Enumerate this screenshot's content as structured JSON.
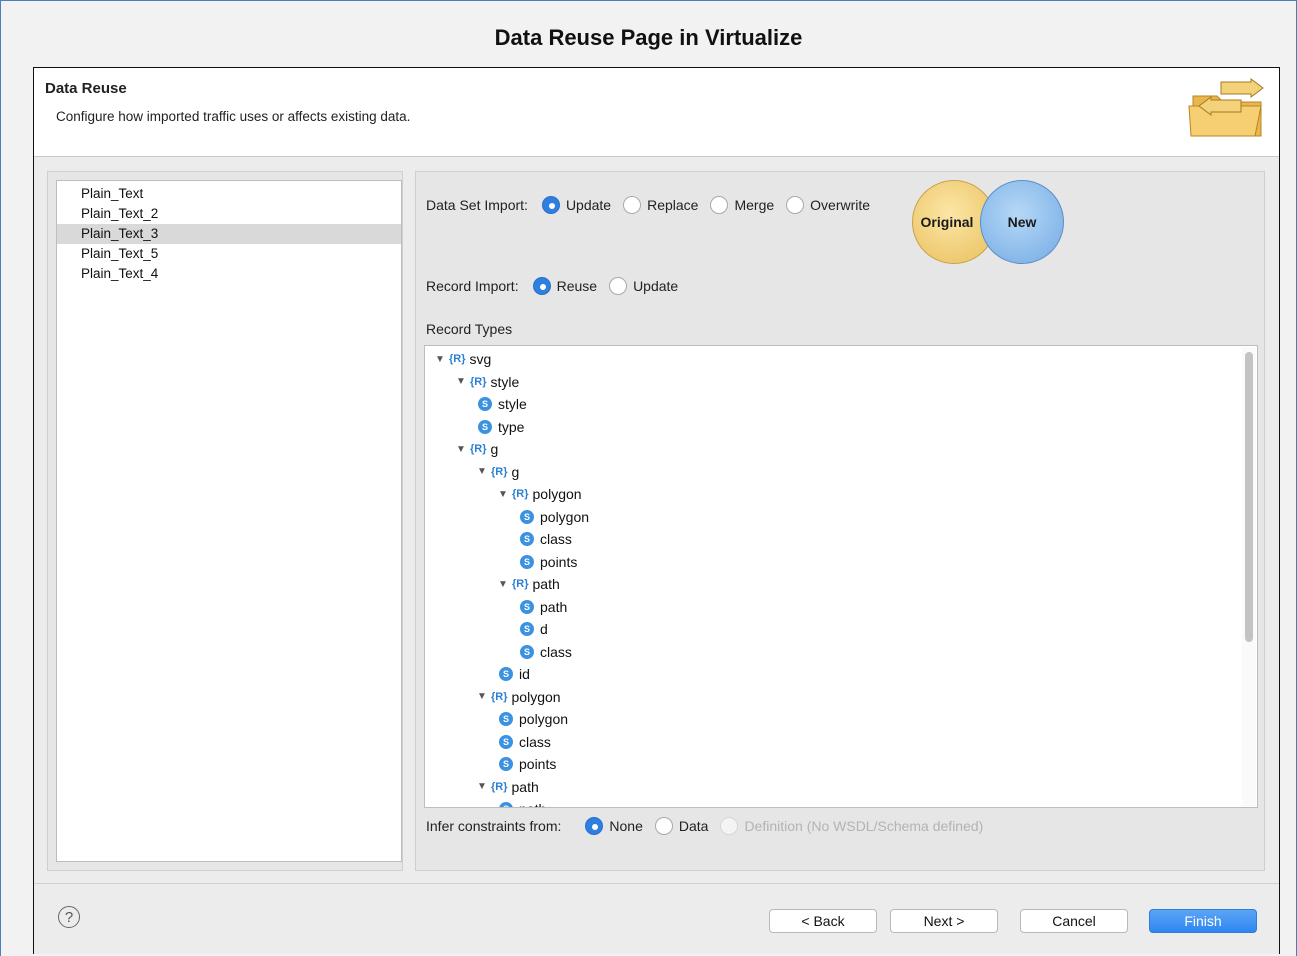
{
  "caption": "Data Reuse Page in Virtualize",
  "banner": {
    "title": "Data Reuse",
    "description": "Configure how imported traffic uses or affects existing data.",
    "icon": "folder-arrows-icon"
  },
  "files": [
    "Plain_Text",
    "Plain_Text_2",
    "Plain_Text_3",
    "Plain_Text_5",
    "Plain_Text_4"
  ],
  "selected_file": "Plain_Text_3",
  "data_set_import": {
    "label": "Data Set Import:",
    "options": [
      "Update",
      "Replace",
      "Merge",
      "Overwrite"
    ],
    "selected": "Update"
  },
  "venn": {
    "left": "Original",
    "right": "New"
  },
  "record_import": {
    "label": "Record Import:",
    "options": [
      "Reuse",
      "Update"
    ],
    "selected": "Reuse"
  },
  "record_types": {
    "title": "Record Types",
    "rows": [
      {
        "kind": "R",
        "name": "svg",
        "depth": 0
      },
      {
        "kind": "R",
        "name": "style",
        "depth": 1
      },
      {
        "kind": "S",
        "name": "style",
        "depth": 2
      },
      {
        "kind": "S",
        "name": "type",
        "depth": 2
      },
      {
        "kind": "R",
        "name": "g",
        "depth": 1
      },
      {
        "kind": "R",
        "name": "g",
        "depth": 2
      },
      {
        "kind": "R",
        "name": "polygon",
        "depth": 3
      },
      {
        "kind": "S",
        "name": "polygon",
        "depth": 4
      },
      {
        "kind": "S",
        "name": "class",
        "depth": 4
      },
      {
        "kind": "S",
        "name": "points",
        "depth": 4
      },
      {
        "kind": "R",
        "name": "path",
        "depth": 3
      },
      {
        "kind": "S",
        "name": "path",
        "depth": 4
      },
      {
        "kind": "S",
        "name": "d",
        "depth": 4
      },
      {
        "kind": "S",
        "name": "class",
        "depth": 4
      },
      {
        "kind": "S",
        "name": "id",
        "depth": 3
      },
      {
        "kind": "R",
        "name": "polygon",
        "depth": 2
      },
      {
        "kind": "S",
        "name": "polygon",
        "depth": 3
      },
      {
        "kind": "S",
        "name": "class",
        "depth": 3
      },
      {
        "kind": "S",
        "name": "points",
        "depth": 3
      },
      {
        "kind": "R",
        "name": "path",
        "depth": 2
      },
      {
        "kind": "S",
        "name": "path",
        "depth": 3
      }
    ]
  },
  "infer": {
    "label": "Infer constraints from:",
    "options": [
      "None",
      "Data",
      "Definition (No WSDL/Schema defined)"
    ],
    "selected": "None",
    "disabled": [
      "Definition (No WSDL/Schema defined)"
    ]
  },
  "footer": {
    "help_icon": "help-icon",
    "back": "< Back",
    "next": "Next >",
    "cancel": "Cancel",
    "finish": "Finish"
  }
}
